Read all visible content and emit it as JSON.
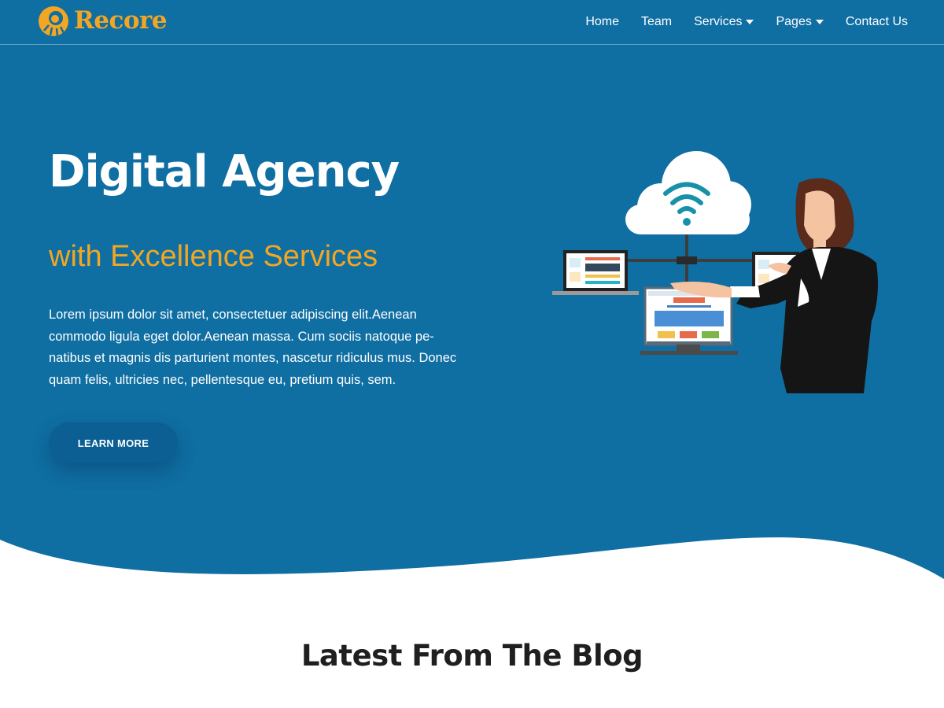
{
  "brand": {
    "name": "Recore",
    "color": "#f2a623"
  },
  "nav": {
    "items": [
      {
        "label": "Home",
        "dropdown": false
      },
      {
        "label": "Team",
        "dropdown": false
      },
      {
        "label": "Services",
        "dropdown": true
      },
      {
        "label": "Pages",
        "dropdown": true
      },
      {
        "label": "Contact Us",
        "dropdown": false
      }
    ]
  },
  "hero": {
    "title": "Digital Agency",
    "subtitle": "with Excellence Services",
    "text": "Lorem ipsum dolor sit amet, consectetuer adipiscing elit.Aenean commodo ligula eget dolor.Aenean massa. Cum sociis natoque pe-natibus et magnis dis parturient montes, nascetur ridiculus mus. Donec quam felis, ultricies nec, pellentesque eu, pretium quis, sem.",
    "cta_label": "LEARN MORE",
    "background": "#0f6ea2"
  },
  "blog": {
    "title": "Latest From The Blog"
  },
  "icons": {
    "logo": "sun-logo-icon",
    "dropdown": "caret-down-icon",
    "illustration": "cloud-network-woman-illustration"
  }
}
